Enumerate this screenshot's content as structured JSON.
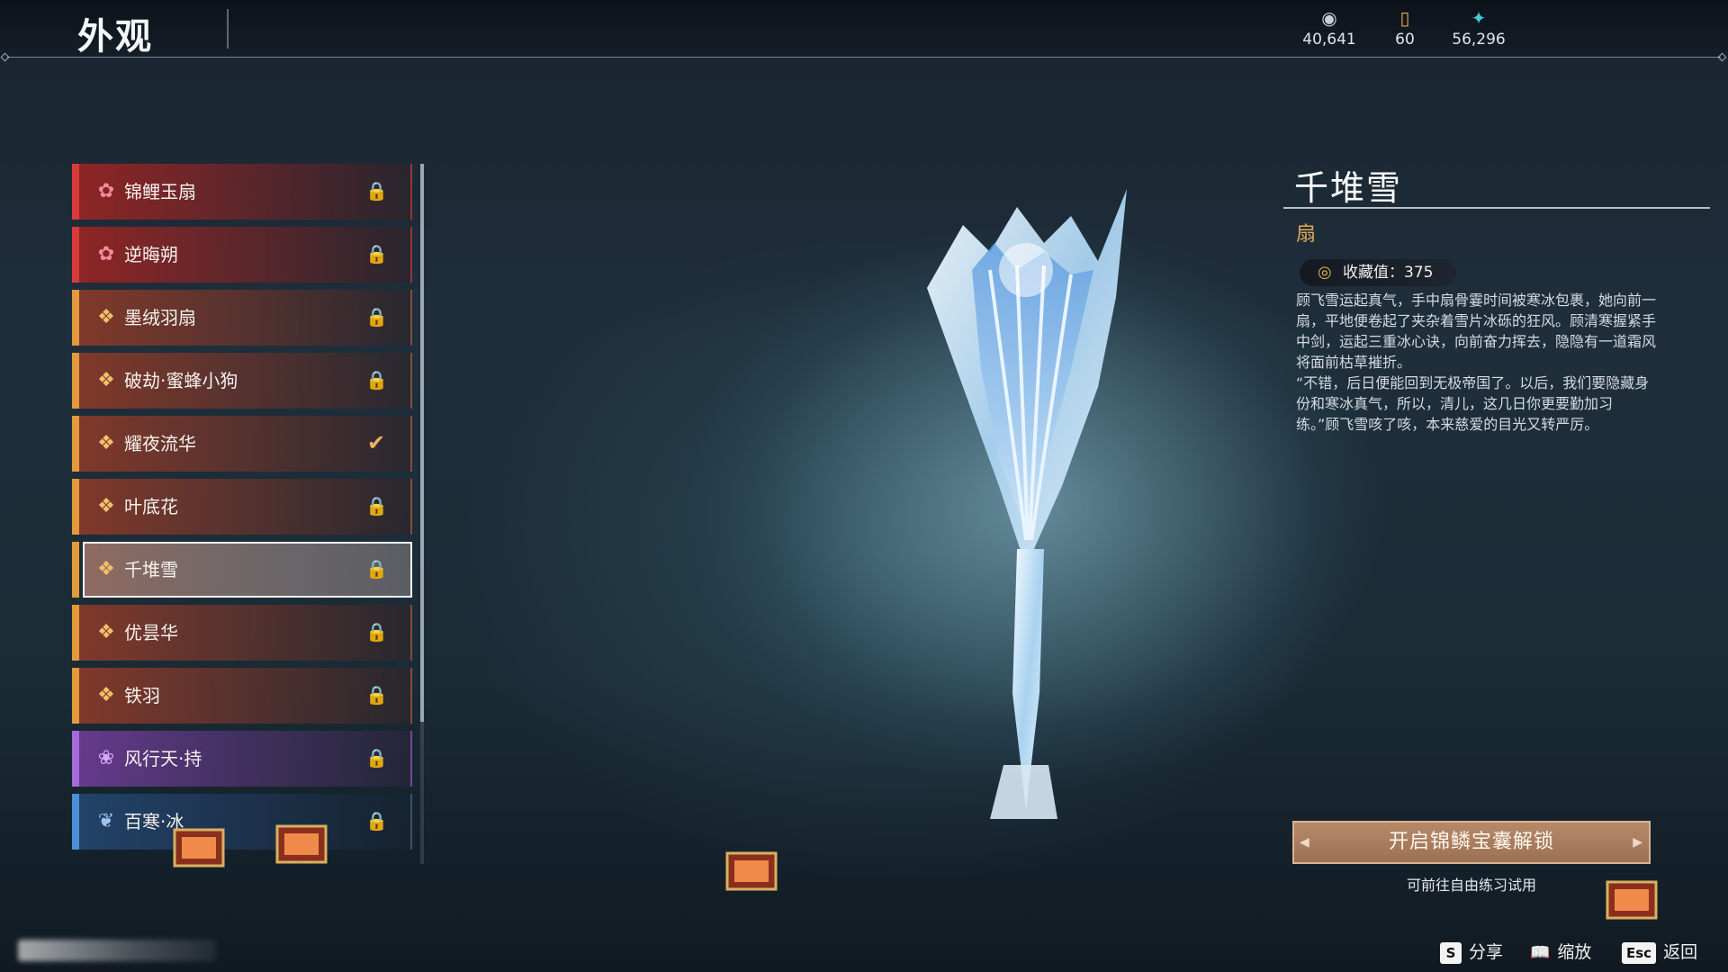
{
  "header": {
    "title": "外观",
    "currencies": [
      {
        "icon": "coin-pouch-icon",
        "value": "40,641"
      },
      {
        "icon": "ticket-icon",
        "value": "60"
      },
      {
        "icon": "feather-icon",
        "value": "56,296"
      }
    ]
  },
  "list": {
    "items": [
      {
        "name": "锦鲤玉扇",
        "rarity": "red",
        "status": "locked"
      },
      {
        "name": "逆晦朔",
        "rarity": "red",
        "status": "locked"
      },
      {
        "name": "墨绒羽扇",
        "rarity": "gold",
        "status": "locked"
      },
      {
        "name": "破劫·蜜蜂小狗",
        "rarity": "gold",
        "status": "locked"
      },
      {
        "name": "耀夜流华",
        "rarity": "gold",
        "status": "equipped"
      },
      {
        "name": "叶底花",
        "rarity": "gold",
        "status": "locked"
      },
      {
        "name": "千堆雪",
        "rarity": "gold",
        "status": "locked",
        "selected": true
      },
      {
        "name": "优昙华",
        "rarity": "gold",
        "status": "locked"
      },
      {
        "name": "铁羽",
        "rarity": "gold",
        "status": "locked"
      },
      {
        "name": "风行天·持",
        "rarity": "purple",
        "status": "locked"
      },
      {
        "name": "百寒·冰",
        "rarity": "blue",
        "status": "locked"
      }
    ],
    "colors": {
      "red": "#d83a3a",
      "gold": "#e39a3c",
      "purple": "#a46ad8",
      "blue": "#4a8fd8"
    }
  },
  "detail": {
    "name": "千堆雪",
    "type": "扇",
    "collection_label": "收藏值：375",
    "description": [
      "顾飞雪运起真气，手中扇骨霎时间被寒冰包裹，她向前一扇，平地便卷起了夹杂着雪片冰砾的狂风。顾清寒握紧手中剑，运起三重冰心诀，向前奋力挥去，隐隐有一道霜风将面前枯草摧折。",
      "“不错，后日便能回到无极帝国了。以后，我们要隐藏身份和寒冰真气，所以，清儿，这几日你更要勤加习练。”顾飞雪咳了咳，本来慈爱的目光又转严厉。"
    ],
    "unlock_button": "开启锦鳞宝囊解锁",
    "trial_hint": "可前往自由练习试用",
    "accent_color": "#e8a85a"
  },
  "footer": {
    "share": {
      "key": "S",
      "label": "分享"
    },
    "zoom": {
      "icon": "book-icon",
      "label": "缩放"
    },
    "back": {
      "key": "Esc",
      "label": "返回"
    }
  }
}
